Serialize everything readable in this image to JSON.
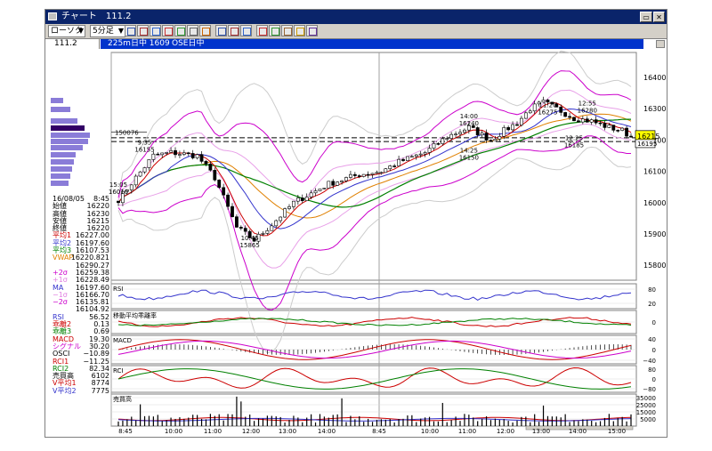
{
  "window": {
    "title": "チャート　111.2",
    "close_glyph": "✕"
  },
  "toolbar": {
    "chart_type": "ローソク",
    "interval": "5分足"
  },
  "info": {
    "symbol": "111.2",
    "name": "225m日中 1609",
    "market": "OSE日中"
  },
  "price_axis": [
    "16400",
    "16300",
    "16200",
    "16100",
    "16000",
    "15900",
    "15800"
  ],
  "price_markers": {
    "current": "16215",
    "box": "16195",
    "volume_level": "150076"
  },
  "annotations": [
    {
      "time": "9:35",
      "price": "16155"
    },
    {
      "time": "15:05",
      "price": "16010"
    },
    {
      "time": "10:45",
      "price": "15865"
    },
    {
      "time": "14:00",
      "price": "16240"
    },
    {
      "time": "14:25",
      "price": "16150"
    },
    {
      "time": "11:20",
      "price": "16275"
    },
    {
      "time": "12:55",
      "price": "16280"
    },
    {
      "time": "12:25",
      "price": "16185"
    }
  ],
  "time_axis": [
    "8:45",
    "10:00",
    "11:00",
    "12:00",
    "13:00",
    "14:00",
    "8:45",
    "10:00",
    "11:00",
    "12:00",
    "13:00",
    "14:00",
    "15:00"
  ],
  "sub_panels": [
    {
      "label": "RSI",
      "ticks": [
        "80",
        "20"
      ]
    },
    {
      "label": "移動平均乖離率",
      "ticks": [
        "0"
      ]
    },
    {
      "label": "MACD",
      "ticks": [
        "40",
        "0",
        "−40"
      ]
    },
    {
      "label": "RCI",
      "ticks": [
        "80",
        "0",
        "−80"
      ]
    },
    {
      "label": "売買高",
      "ticks": [
        "35000",
        "25000",
        "15000",
        "5000"
      ]
    }
  ],
  "data_table": {
    "date": "16/08/05",
    "time": "8:45",
    "rows": [
      {
        "label": "始値",
        "value": "16220",
        "color": "#000000"
      },
      {
        "label": "高値",
        "value": "16230",
        "color": "#000000"
      },
      {
        "label": "安値",
        "value": "16215",
        "color": "#000000"
      },
      {
        "label": "終値",
        "value": "16220",
        "color": "#000000"
      },
      {
        "label": "平均1",
        "value": "16227.00",
        "color": "#cc0000"
      },
      {
        "label": "平均2",
        "value": "16197.60",
        "color": "#3333cc"
      },
      {
        "label": "平均3",
        "value": "16107.53",
        "color": "#008000"
      },
      {
        "label": "VWAP",
        "value": "16220.821",
        "color": "#e08000"
      },
      {
        "label": "",
        "value": "16290.27",
        "color": "#000000"
      },
      {
        "label": "+2σ",
        "value": "16259.38",
        "color": "#cc00cc"
      },
      {
        "label": "+1σ",
        "value": "16228.49",
        "color": "#e080e0"
      },
      {
        "label": "MA",
        "value": "16197.60",
        "color": "#3333cc"
      },
      {
        "label": "−1σ",
        "value": "16166.70",
        "color": "#e080e0"
      },
      {
        "label": "−2σ",
        "value": "16135.81",
        "color": "#cc00cc"
      },
      {
        "label": "",
        "value": "16104.92",
        "color": "#000000"
      },
      {
        "label": "RSI",
        "value": "56.52",
        "color": "#3333cc"
      },
      {
        "label": "乖離2",
        "value": "0.13",
        "color": "#cc0000"
      },
      {
        "label": "乖離3",
        "value": "0.69",
        "color": "#008000"
      },
      {
        "label": "MACD",
        "value": "19.30",
        "color": "#cc0000"
      },
      {
        "label": "シグナル",
        "value": "30.20",
        "color": "#cc00cc"
      },
      {
        "label": "OSCI",
        "value": "−10.89",
        "color": "#000000"
      },
      {
        "label": "RCI1",
        "value": "−11.25",
        "color": "#cc0000"
      },
      {
        "label": "RCI2",
        "value": "82.34",
        "color": "#008000"
      },
      {
        "label": "売買高",
        "value": "6102",
        "color": "#000000"
      },
      {
        "label": "V平均1",
        "value": "8774",
        "color": "#cc0000"
      },
      {
        "label": "V平均2",
        "value": "7775",
        "color": "#3333cc"
      }
    ]
  },
  "colors": {
    "title_bar": "#0a246a",
    "info_bar": "#0033cc",
    "candle_up": "#ffffff",
    "candle_down": "#000000",
    "ma1": "#cc0000",
    "ma2": "#3333cc",
    "ma3": "#008000",
    "vwap": "#e08000",
    "bollinger": "#cc00cc",
    "current_price": "#ffff00"
  }
}
